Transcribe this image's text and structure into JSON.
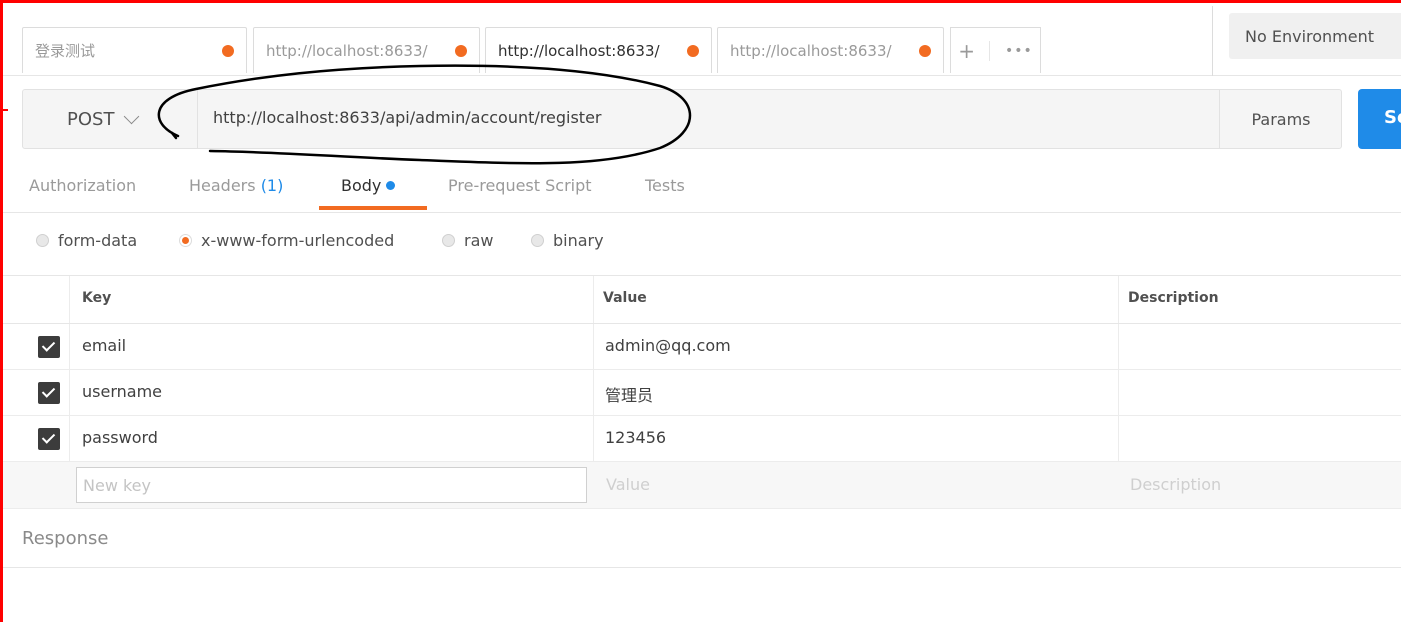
{
  "tabs": [
    {
      "label": "登录测试",
      "active": false
    },
    {
      "label": "http://localhost:8633/",
      "active": false
    },
    {
      "label": "http://localhost:8633/",
      "active": true
    },
    {
      "label": "http://localhost:8633/",
      "active": false
    }
  ],
  "tab_actions": {
    "add": "+",
    "more": "•••"
  },
  "environment": "No Environment",
  "request": {
    "method": "POST",
    "url": "http://localhost:8633/api/admin/account/register",
    "params_label": "Params",
    "send_label": "Send"
  },
  "subtabs": {
    "authorization": "Authorization",
    "headers": "Headers",
    "headers_count": "(1)",
    "body": "Body",
    "prerequest": "Pre-request Script",
    "tests": "Tests"
  },
  "body_types": {
    "form_data": "form-data",
    "urlencoded": "x-www-form-urlencoded",
    "raw": "raw",
    "binary": "binary",
    "selected": "x-www-form-urlencoded"
  },
  "table": {
    "headers": {
      "key": "Key",
      "value": "Value",
      "description": "Description"
    },
    "rows": [
      {
        "checked": true,
        "key": "email",
        "value": "admin@qq.com",
        "description": ""
      },
      {
        "checked": true,
        "key": "username",
        "value": "管理员",
        "description": ""
      },
      {
        "checked": true,
        "key": "password",
        "value": "123456",
        "description": ""
      }
    ],
    "new_row": {
      "key_placeholder": "New key",
      "value_placeholder": "Value",
      "description_placeholder": "Description"
    }
  },
  "response_label": "Response",
  "colors": {
    "accent_orange": "#f26b21",
    "accent_blue": "#1f8be8",
    "highlight_red": "#ff0000"
  }
}
